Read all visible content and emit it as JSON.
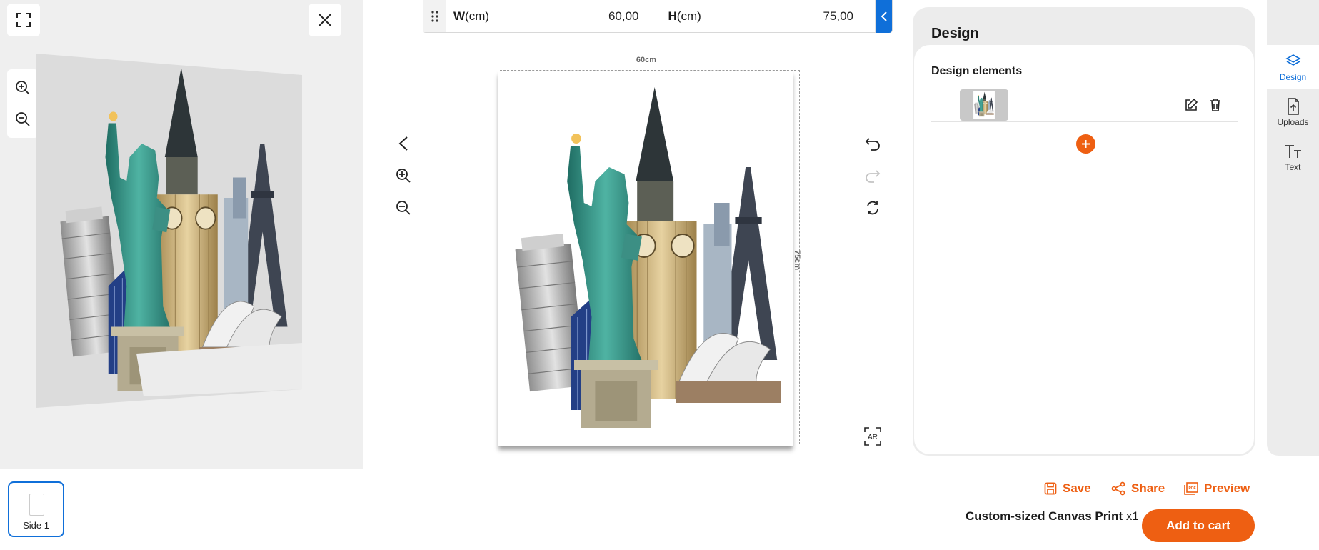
{
  "dimensions": {
    "width_label_bold": "W",
    "width_label_unit": "(cm)",
    "width_value": "60,00",
    "height_label_bold": "H",
    "height_label_unit": "(cm)",
    "height_value": "75,00",
    "top_label": "60cm",
    "side_label": "75cm"
  },
  "design_panel": {
    "title": "Design",
    "elements_heading": "Design elements"
  },
  "right_rail": {
    "items": [
      {
        "label": "Design",
        "icon": "layers-icon",
        "active": true
      },
      {
        "label": "Uploads",
        "icon": "upload-icon",
        "active": false
      },
      {
        "label": "Text",
        "icon": "text-icon",
        "active": false
      }
    ]
  },
  "sides": [
    {
      "label": "Side 1",
      "selected": true
    }
  ],
  "actions": {
    "save_label": "Save",
    "share_label": "Share",
    "preview_label": "Preview"
  },
  "product": {
    "name": "Custom-sized Canvas Print",
    "quantity": "x1"
  },
  "cart": {
    "add_label": "Add to cart"
  },
  "colors": {
    "accent_orange": "#ee5f12",
    "accent_blue": "#0f6fd9"
  }
}
